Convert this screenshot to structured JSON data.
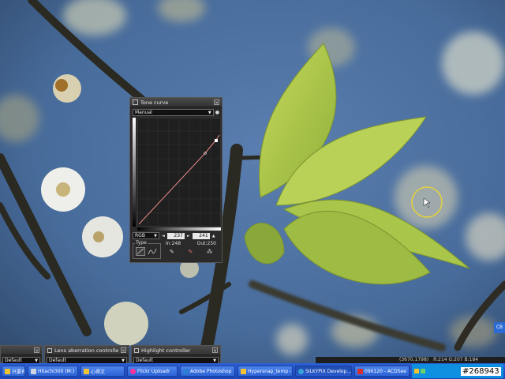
{
  "tone_curve": {
    "title": "Tone curve",
    "mode": "Manual",
    "channel": "RGB",
    "input_value": "237",
    "output_value": "241",
    "in_label": "In:248",
    "out_label": "Out:250",
    "type_label": "Type"
  },
  "bottom_panels": {
    "lens_title": "Lens aberration controller",
    "lens_preset": "Default",
    "highlight_title": "Highlight controller",
    "highlight_preset": "Default",
    "left_preset": "Default"
  },
  "status": {
    "coords": "(3670,1798)",
    "rgb": "R:214 G:207 B:184"
  },
  "side_tab": "CB",
  "watermark": "#268943",
  "taskbar": {
    "items": [
      {
        "label": "只要有",
        "color": "#f2c230"
      },
      {
        "label": "Hitachi300 (M:)",
        "color": "#cfd6e0"
      },
      {
        "label": "心得文",
        "color": "#f2c230"
      },
      {
        "label": "Flickr Uploadr",
        "color": "#ff3399"
      },
      {
        "label": "Adobe Photoshop",
        "color": "#2d7fd4"
      },
      {
        "label": "Hypersnap_temp -",
        "color": "#f2c230"
      },
      {
        "label": "SILKYPIX Develop...",
        "color": "#3aa0d8"
      },
      {
        "label": "090120 - ACDSee",
        "color": "#d83030"
      }
    ]
  },
  "colors": {
    "sky": "#476b9a",
    "leaf": "#b6cf53",
    "panel_bg": "#2a2a2a"
  }
}
